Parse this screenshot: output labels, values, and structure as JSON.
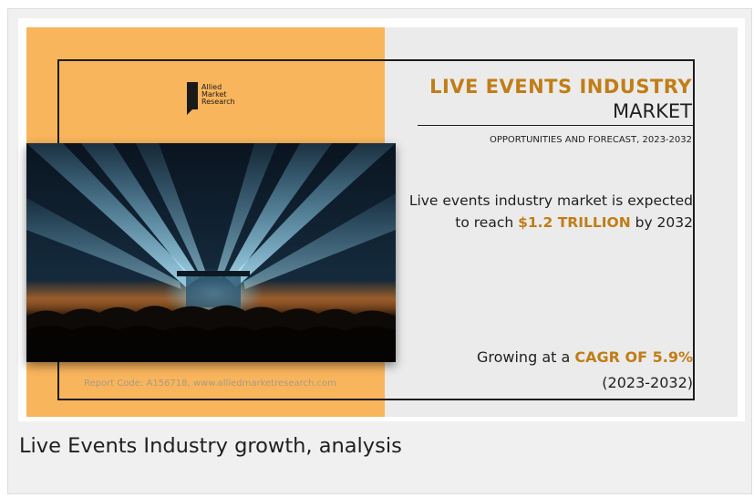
{
  "banner": {
    "logo": {
      "line1": "Allied",
      "line2": "Market",
      "line3": "Research"
    },
    "title_line1": "LIVE EVENTS INDUSTRY",
    "title_line2": "MARKET",
    "subtitle": "OPPORTUNITIES AND FORECAST, 2023-2032",
    "statement": {
      "prefix": "Live events industry market is expected to reach ",
      "highlight": "$1.2 TRILLION",
      "suffix": " by 2032"
    },
    "growth": {
      "prefix": "Growing at a ",
      "highlight": "CAGR OF 5.9%",
      "period": "(2023-2032)"
    },
    "report_code": "Report Code: A156718, www.alliedmarketresearch.com",
    "colors": {
      "accent": "#c17d16",
      "left_panel": "#f9b55c",
      "right_panel": "#ebebeb"
    }
  },
  "caption": "Live Events Industry growth, analysis"
}
